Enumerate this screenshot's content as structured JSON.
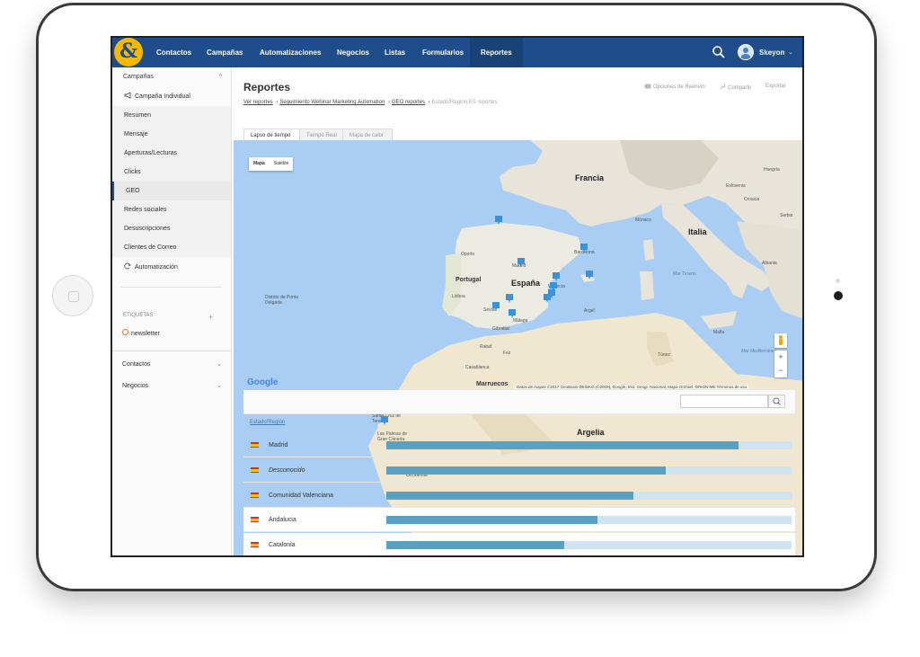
{
  "nav": {
    "logo": "&",
    "items": [
      "Contactos",
      "Campañas",
      "Automatizaciones",
      "Negocios",
      "Listas",
      "Formularios",
      "Reportes"
    ],
    "active": "Reportes",
    "user_name": "Skeyon",
    "user_caret": "⌄"
  },
  "sidebar": {
    "section_title": "Campañas",
    "section_caret": "^",
    "items": [
      "Campaña Individual",
      "Resumen",
      "Mensaje",
      "Aperturas/Lecturas",
      "Clicks",
      "GEO",
      "Redes sociales",
      "Desuscripciones",
      "Clientes de Correo",
      "Automatización"
    ],
    "active": "GEO",
    "tags_title": "ETIQUETAS",
    "tags_add": "+",
    "tag": "newsletter",
    "contacts": "Contactos",
    "deals": "Negocios",
    "caret": "⌄"
  },
  "header": {
    "title": "Reportes",
    "breadcrumb": [
      "Ver reportes",
      "Seguimiento Webinar Marketing Automation",
      "GEO reportes",
      "Estado/Región ES reportes"
    ],
    "breadcrumb_sep": "›",
    "actions": [
      "Opciones de Reenvío",
      "Compartir",
      "Exportar"
    ]
  },
  "tabs": [
    "Lapso de tiempo",
    "Tiempo Real",
    "Mapa de calor"
  ],
  "map": {
    "type_buttons": [
      "Mapa",
      "Satélite"
    ],
    "labels": {
      "francia": "Francia",
      "espana": "España",
      "portugal": "Portugal",
      "italia": "Italia",
      "argelia": "Argelia",
      "marruecos": "Marruecos",
      "monaco": "Mónaco",
      "oporto": "Oporto",
      "lisboa": "Lisboa",
      "madrid": "Madrid",
      "barcelona": "Barcelona",
      "valencia": "Valencia",
      "sevilla": "Sevilla",
      "malaga": "Málaga",
      "gibraltar": "Gibraltar",
      "argel": "Argel",
      "tunez": "Túnez",
      "malta": "Malta",
      "rabat": "Rabat",
      "fez": "Fez",
      "casablanca": "Casablanca",
      "croacia": "Croacia",
      "hungria": "Hungría",
      "eslovenia": "Eslovenia",
      "serbia": "Serbia",
      "albania": "Albania",
      "mar_tirreno": "Mar Tirreno",
      "mar_medit": "Mar Mediterráneo",
      "azores": "Distrito de Ponta Delgada",
      "occidental": "Occidental",
      "las_palmas": "Las Palmas de Gran Canaria",
      "santa_cruz": "Santa Cruz de Tenerife"
    },
    "attribution": "Datos de mapas ©2017 GeoBasis-DE/BKG (©2009), Google, Inst. Geogr. Nacional, Mapa GISrael, ORION-ME  Términos de uso",
    "google": "Google",
    "zoom_in": "+",
    "zoom_out": "−"
  },
  "table": {
    "column_header": "Estado/Región",
    "rows": [
      {
        "label": "Madrid",
        "italic": false,
        "value": 0.87
      },
      {
        "label": "Desconocido",
        "italic": true,
        "value": 0.69
      },
      {
        "label": "Comunidad Valenciana",
        "italic": false,
        "value": 0.61
      },
      {
        "label": "Andalucia",
        "italic": false,
        "value": 0.52
      },
      {
        "label": "Catalonia",
        "italic": false,
        "value": 0.44
      }
    ]
  },
  "colors": {
    "nav": "#1f4d8c",
    "logo": "#f6b800",
    "bar": "#5aa0c2",
    "bar_track": "#cfe3f0",
    "sea": "#a9cdf3",
    "marker": "#3a92d8"
  }
}
